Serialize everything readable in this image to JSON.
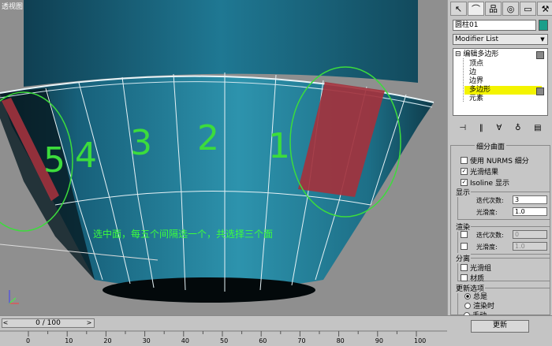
{
  "viewport": {
    "label": "透视图",
    "annotation_text": "选中面，每五个间隔选一个，共选择三个面",
    "face_numbers": [
      "5",
      "4",
      "3",
      "2",
      "1"
    ]
  },
  "panel": {
    "tabs": [
      {
        "icon": "pointer-icon",
        "glyph": "↖"
      },
      {
        "icon": "curve-icon",
        "glyph": "⌒"
      },
      {
        "icon": "hierarchy-icon",
        "glyph": "品"
      },
      {
        "icon": "motion-icon",
        "glyph": "◎"
      },
      {
        "icon": "display-icon",
        "glyph": "▭"
      },
      {
        "icon": "utilities-icon",
        "glyph": "⚒"
      }
    ],
    "object_name": "圆柱01",
    "object_color": "#1a9e8a",
    "modifier_list": "Modifier List",
    "stack": {
      "root": "编辑多边形",
      "items": [
        "顶点",
        "边",
        "边界",
        "多边形",
        "元素"
      ],
      "selected": "多边形"
    },
    "rollout": {
      "header": "细分曲面",
      "use_nurms": "使用 NURMS 细分",
      "smooth_result": "光滑结果",
      "isoline": "Isoline 显示",
      "display_group": "显示",
      "iterations_label": "迭代次数:",
      "iterations_value": "3",
      "smoothness_label": "光滑度:",
      "smoothness_value": "1.0",
      "render_group": "渲染",
      "render_iterations_value": "0",
      "render_smoothness_value": "1.0",
      "separate_group": "分离",
      "by_smoothing_groups": "光滑组",
      "by_materials": "材质",
      "update_group": "更新选项",
      "always": "总是",
      "when_rendering": "渲染时",
      "manually": "手动",
      "update_button": "更新"
    }
  },
  "timeline": {
    "slider_text": "0 / 100",
    "ticks": [
      "0",
      "10",
      "20",
      "30",
      "40",
      "50",
      "60",
      "70",
      "80",
      "90",
      "100"
    ]
  }
}
